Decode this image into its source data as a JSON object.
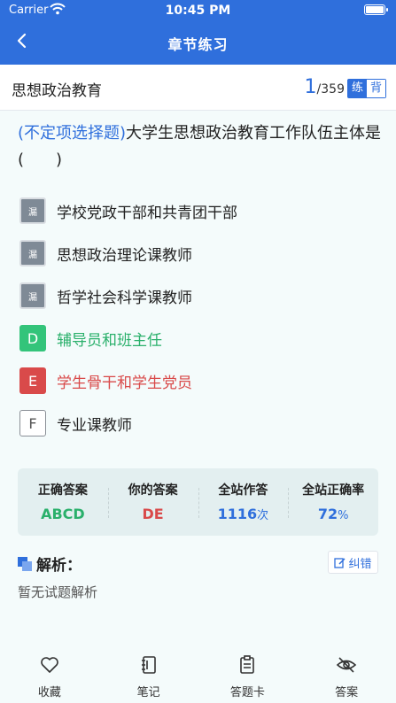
{
  "status_bar": {
    "carrier": "Carrier",
    "time": "10:45 PM"
  },
  "header": {
    "title": "章节练习"
  },
  "subheader": {
    "chapter": "思想政治教育",
    "current": "1",
    "total": "/359",
    "mode_practice": "练",
    "mode_recite": "背"
  },
  "question": {
    "type": "(不定项选择题)",
    "text": "大学生思想政治教育工作队伍主体是(　　)"
  },
  "options": [
    {
      "badge": "漏",
      "text": "学校党政干部和共青团干部"
    },
    {
      "badge": "漏",
      "text": "思想政治理论课教师"
    },
    {
      "badge": "漏",
      "text": "哲学社会科学课教师"
    },
    {
      "badge": "D",
      "text": "辅导员和班主任"
    },
    {
      "badge": "E",
      "text": "学生骨干和学生党员"
    },
    {
      "badge": "F",
      "text": "专业课教师"
    }
  ],
  "stats": {
    "correct_label": "正确答案",
    "correct_value": "ABCD",
    "mine_label": "你的答案",
    "mine_value": "DE",
    "count_label": "全站作答",
    "count_value": "1116",
    "count_unit": "次",
    "rate_label": "全站正确率",
    "rate_value": "72",
    "rate_unit": "%"
  },
  "analysis": {
    "title": "解析：",
    "report_label": "纠错",
    "body": "暂无试题解析"
  },
  "tabbar": [
    {
      "label": "收藏",
      "icon": "heart-icon"
    },
    {
      "label": "笔记",
      "icon": "notebook-icon"
    },
    {
      "label": "答题卡",
      "icon": "clipboard-icon"
    },
    {
      "label": "答案",
      "icon": "eye-off-icon"
    }
  ],
  "colors": {
    "primary": "#2f6fdc",
    "correct": "#33c47a",
    "wrong": "#d94a4a",
    "missed": "#7f8a96"
  }
}
